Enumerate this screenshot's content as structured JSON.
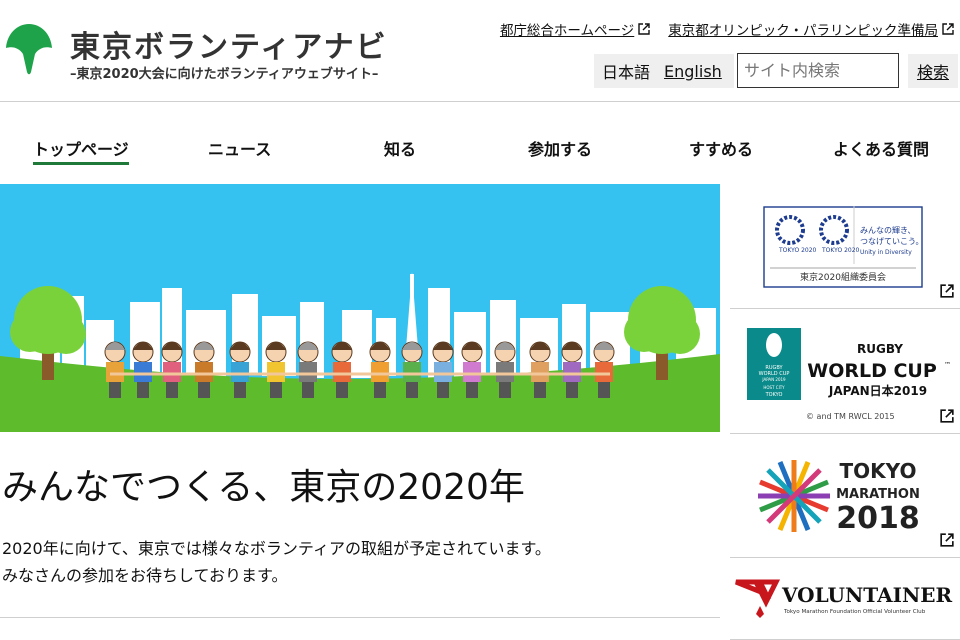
{
  "site": {
    "title": "東京ボランティアナビ",
    "subtitle": "–東京2020大会に向けたボランティアウェブサイト–"
  },
  "top_links": [
    {
      "label": "都庁総合ホームページ"
    },
    {
      "label": "東京都オリンピック・パラリンピック準備局"
    }
  ],
  "lang": {
    "ja": "日本語",
    "en": "English"
  },
  "search": {
    "placeholder": "サイト内検索",
    "button": "検索"
  },
  "nav": [
    {
      "label": "トップページ",
      "active": true
    },
    {
      "label": "ニュース"
    },
    {
      "label": "知る"
    },
    {
      "label": "参加する"
    },
    {
      "label": "すすめる"
    },
    {
      "label": "よくある質問"
    }
  ],
  "hero": {
    "title": "みんなでつくる、東京の2020年",
    "text_line1": "2020年に向けて、東京では様々なボランティアの取組が予定されています。",
    "text_line2": "みなさんの参加をお待ちしております。"
  },
  "banners": {
    "tokyo2020": {
      "tokyo_label_1": "TOKYO 2020",
      "tokyo_label_2": "TOKYO 2020",
      "tagline_1": "みんなの輝き、",
      "tagline_2": "つなげていこう。",
      "tagline_en": "Unity in Diversity",
      "caption": "東京2020組織委員会"
    },
    "rugby": {
      "line1": "RUGBY",
      "line2": "WORLD CUP",
      "tm": "™",
      "line3": "JAPAN日本2019",
      "copyright": "© and TM RWCL 2015",
      "logo_rugby": "RUGBY",
      "logo_wc": "WORLD CUP",
      "logo_japan": "JAPAN 2019",
      "logo_host": "HOST CITY",
      "logo_tokyo": "TOKYO"
    },
    "marathon": {
      "line1": "TOKYO",
      "line2": "MARATHON",
      "line3": "2018"
    },
    "voluntainer": {
      "title": "VOLUNTAINER",
      "sub": "Tokyo Marathon Foundation Official Volunteer Club"
    }
  },
  "colors": {
    "brand_green": "#1f7a3a",
    "sky": "#36c2f0",
    "grass": "#5dbb2c",
    "olympic_blue": "#1d3c8f",
    "rugby_teal": "#0a8a8a",
    "voluntainer_red": "#c8161d"
  }
}
